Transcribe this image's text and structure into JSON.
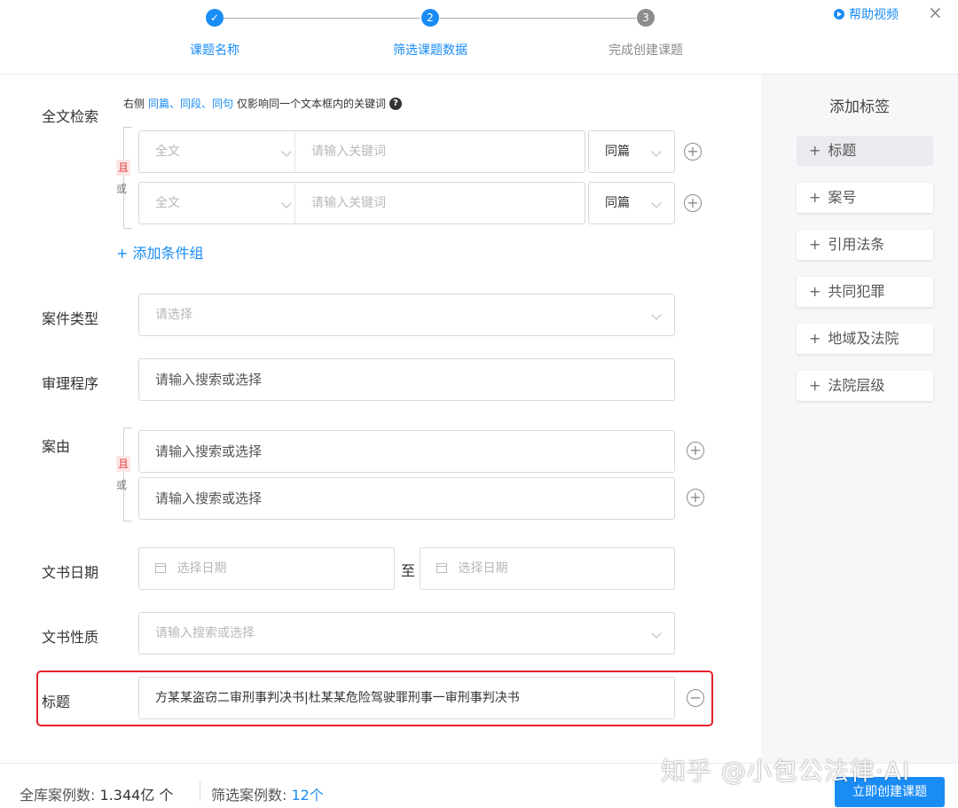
{
  "steps": [
    {
      "num": "✓",
      "label": "课题名称",
      "state": "done"
    },
    {
      "num": "2",
      "label": "筛选课题数据",
      "state": "active"
    },
    {
      "num": "3",
      "label": "完成创建课题",
      "state": "pending"
    }
  ],
  "help_label": "帮助视频",
  "close_label": "×",
  "fulltext": {
    "label": "全文检索",
    "note_prefix": "右侧",
    "note_links": "同篇、同段、同句",
    "note_suffix": "仅影响同一个文本框内的关键词",
    "and": "且",
    "or": "或",
    "rows": [
      {
        "scope": "全文",
        "keyword_placeholder": "请输入关键词",
        "range": "同篇"
      },
      {
        "scope": "全文",
        "keyword_placeholder": "请输入关键词",
        "range": "同篇"
      }
    ],
    "add_group": "+ 添加条件组"
  },
  "case_type": {
    "label": "案件类型",
    "placeholder": "请选择"
  },
  "procedure": {
    "label": "审理程序",
    "placeholder": "请输入搜索或选择"
  },
  "cause": {
    "label": "案由",
    "and": "且",
    "or": "或",
    "rows": [
      "请输入搜索或选择",
      "请输入搜索或选择"
    ]
  },
  "doc_date": {
    "label": "文书日期",
    "from_placeholder": "选择日期",
    "to_label": "至",
    "to_placeholder": "选择日期"
  },
  "doc_nature": {
    "label": "文书性质",
    "placeholder": "请输入搜索或选择"
  },
  "title_field": {
    "label": "标题",
    "value": "方某某盗窃二审刑事判决书|杜某某危险驾驶罪刑事一审刑事判决书"
  },
  "sidebar": {
    "title": "添加标签",
    "tags": [
      "标题",
      "案号",
      "引用法条",
      "共同犯罪",
      "地域及法院",
      "法院层级"
    ]
  },
  "footer": {
    "total_label": "全库案例数:",
    "total_value": "1.344亿 个",
    "filtered_label": "筛选案例数:",
    "filtered_value": "12个",
    "create_button": "立即创建课题"
  },
  "watermark": "知乎 @小包公法律·AI",
  "colors": {
    "accent": "#1a8cf5",
    "danger": "#e5212d"
  }
}
